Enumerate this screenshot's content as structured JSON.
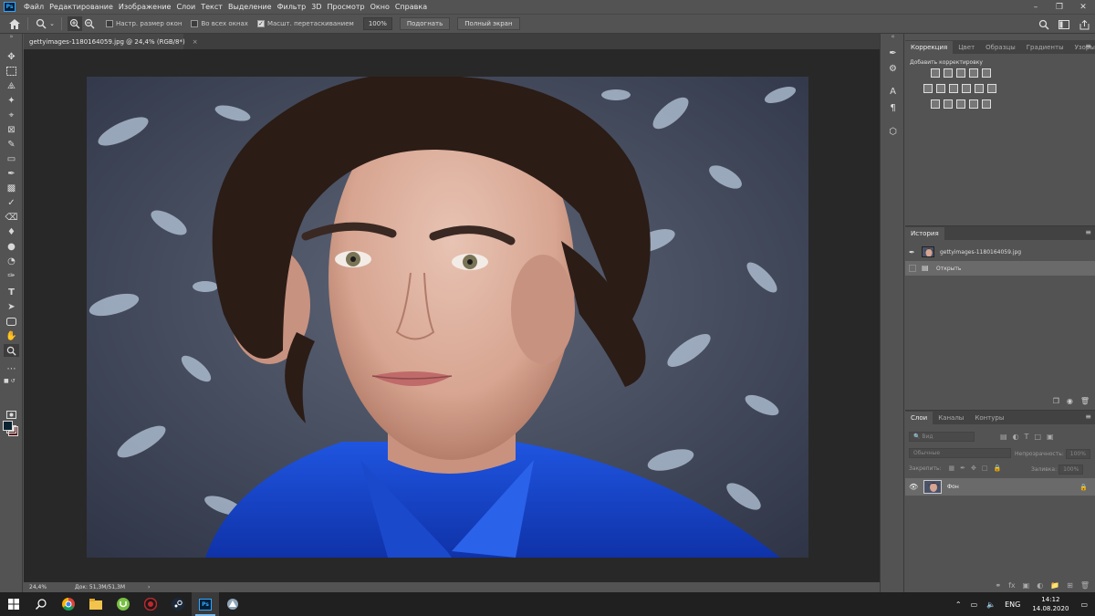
{
  "menu": {
    "items": [
      "Файл",
      "Редактирование",
      "Изображение",
      "Слои",
      "Текст",
      "Выделение",
      "Фильтр",
      "3D",
      "Просмотр",
      "Окно",
      "Справка"
    ]
  },
  "options": {
    "resize_windows": "Настр. размер окон",
    "all_windows": "Во всех окнах",
    "scrubby_zoom": "Масшт. перетаскиванием",
    "zoom_value": "100%",
    "fit_button": "Подогнать",
    "fullscreen_button": "Полный экран"
  },
  "document": {
    "tab_title": "gettyimages-1180164059.jpg @ 24,4% (RGB/8*)",
    "status_zoom": "24,4%",
    "status_doc": "Док: 51,3M/51,3M"
  },
  "adjustments": {
    "tabs": [
      "Коррекция",
      "Цвет",
      "Образцы",
      "Градиенты",
      "Узоры"
    ],
    "add_label": "Добавить корректировку"
  },
  "history": {
    "tab": "История",
    "snapshot_name": "gettyimages-1180164059.jpg",
    "step_open": "Открыть"
  },
  "layers": {
    "tabs": [
      "Слои",
      "Каналы",
      "Контуры"
    ],
    "search_placeholder": "Вид",
    "blend_mode": "Обычные",
    "opacity_label": "Непрозрачность:",
    "opacity_value": "100%",
    "lock_label": "Закрепить:",
    "fill_label": "Заливка:",
    "fill_value": "100%",
    "layer_name": "Фон"
  },
  "taskbar": {
    "language": "ENG",
    "time": "14:12",
    "date": "14.08.2020",
    "active_app_label": "Ps"
  },
  "colors": {
    "foreground": "#0b2230",
    "background": "#5a1a1a",
    "accent": "#31a8ff"
  }
}
